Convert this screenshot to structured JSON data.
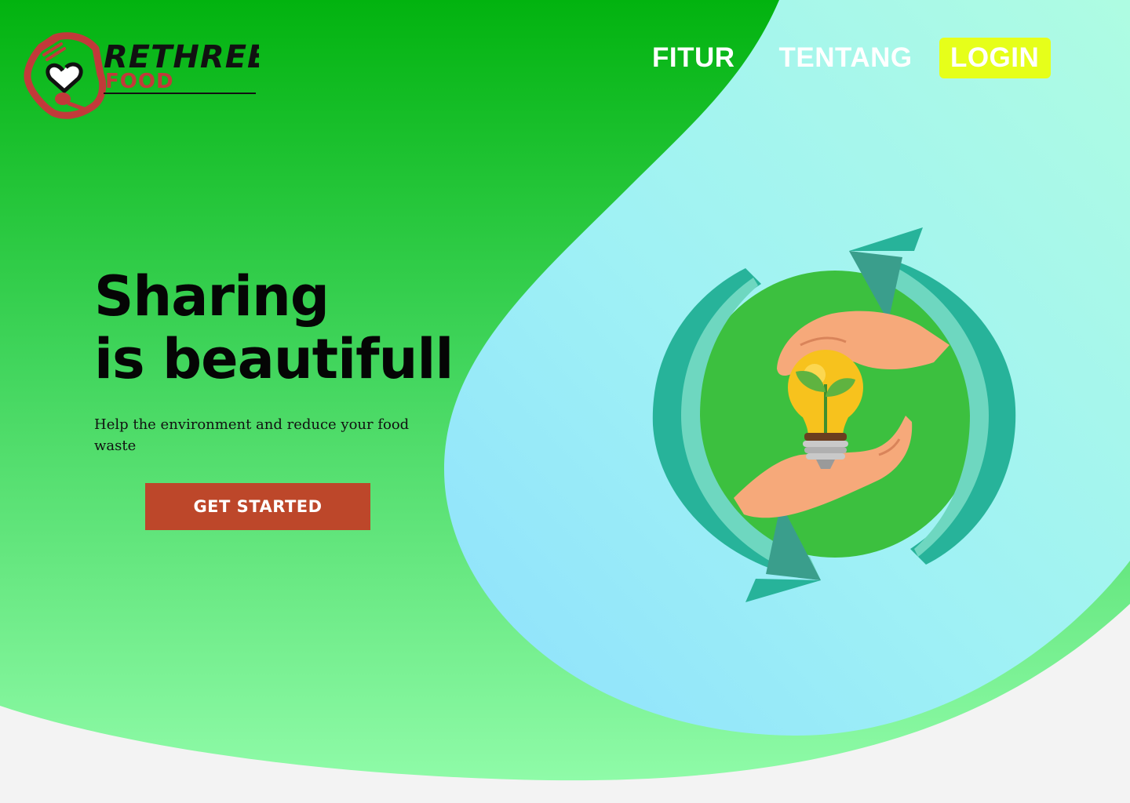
{
  "brand": {
    "name_line1": "RETHREE",
    "name_line2": "FOOD"
  },
  "nav": {
    "items": [
      {
        "label": "FITUR"
      },
      {
        "label": "TENTANG"
      }
    ],
    "login_label": "LOGIN"
  },
  "hero": {
    "title_line1": "Sharing",
    "title_line2": "is beautifull",
    "subtitle": "Help the environment and reduce your food waste",
    "cta_label": "GET STARTED"
  },
  "colors": {
    "green_top": "#02b30f",
    "green_bottom": "#8ffba8",
    "blob_light": "#a6fbe6",
    "blob_blue": "#8ee4fb",
    "accent_login": "#e6ff1a",
    "cta": "#bd472a",
    "logo_red": "#c23a3a"
  },
  "icons": {
    "illustration": "recycle-arrows-hands-lightbulb-icon",
    "logo": "heart-fork-spoon-icon"
  }
}
